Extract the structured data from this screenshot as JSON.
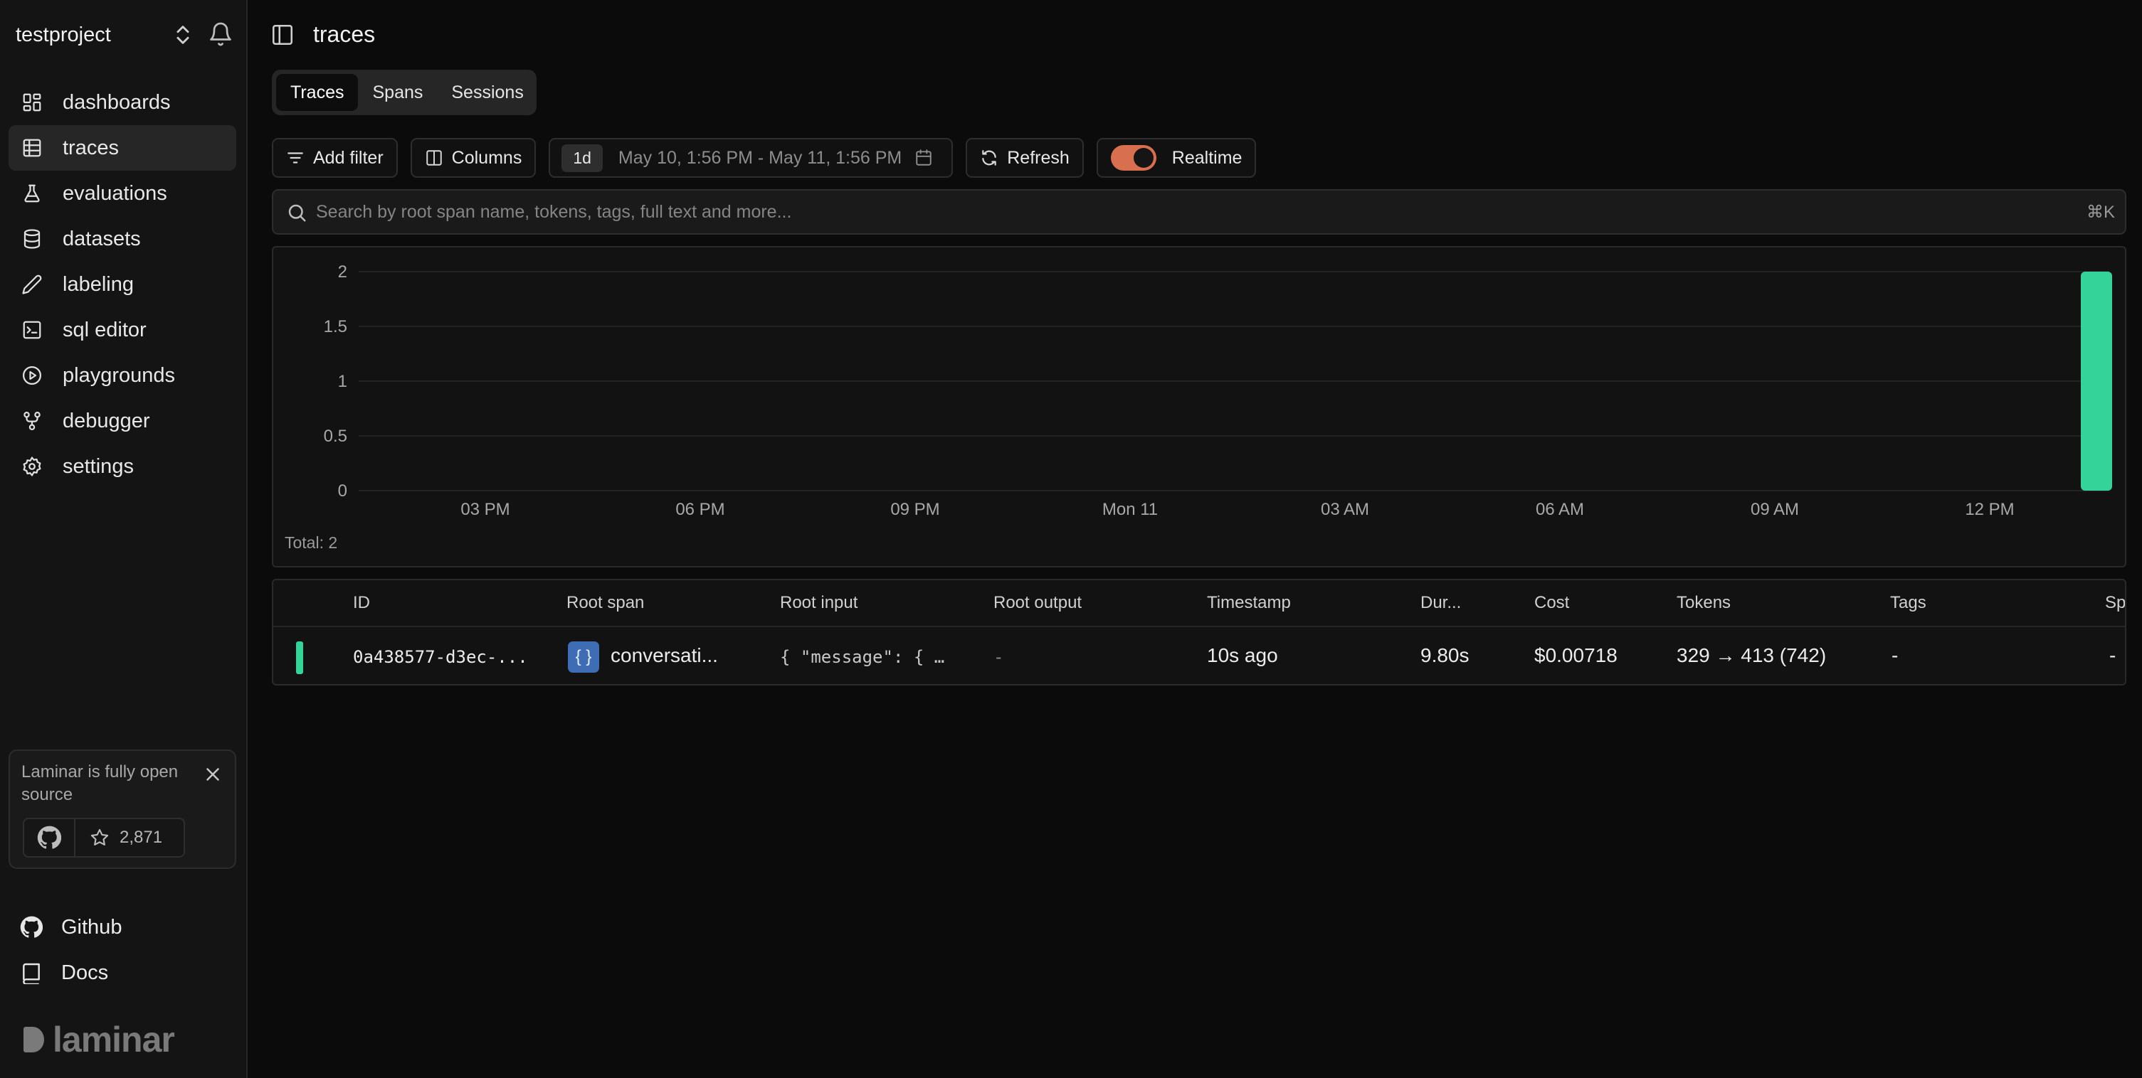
{
  "sidebar": {
    "project_name": "testproject",
    "nav": [
      {
        "label": "dashboards",
        "icon": "dashboard-icon"
      },
      {
        "label": "traces",
        "icon": "rows-icon",
        "active": true
      },
      {
        "label": "evaluations",
        "icon": "flask-icon"
      },
      {
        "label": "datasets",
        "icon": "database-icon"
      },
      {
        "label": "labeling",
        "icon": "pen-icon"
      },
      {
        "label": "sql editor",
        "icon": "terminal-icon"
      },
      {
        "label": "playgrounds",
        "icon": "play-circle-icon"
      },
      {
        "label": "debugger",
        "icon": "git-fork-icon"
      },
      {
        "label": "settings",
        "icon": "gear-icon"
      }
    ],
    "promo": {
      "text": "Laminar is fully open source",
      "stars": "2,871"
    },
    "bottom_links": [
      {
        "label": "Github",
        "icon": "github-icon"
      },
      {
        "label": "Docs",
        "icon": "book-icon"
      }
    ],
    "brand": "laminar"
  },
  "header": {
    "title": "traces"
  },
  "tabs": [
    {
      "label": "Traces",
      "active": true
    },
    {
      "label": "Spans"
    },
    {
      "label": "Sessions"
    }
  ],
  "toolbar": {
    "add_filter": "Add filter",
    "columns": "Columns",
    "range_badge": "1d",
    "range_text": "May 10, 1:56 PM - May 11, 1:56 PM",
    "refresh": "Refresh",
    "realtime": "Realtime",
    "realtime_on": true
  },
  "search": {
    "placeholder": "Search by root span name, tokens, tags, full text and more...",
    "shortcut": "⌘K"
  },
  "chart_data": {
    "type": "bar",
    "y_ticks": [
      "0",
      "0.5",
      "1",
      "1.5",
      "2"
    ],
    "x_ticks": [
      "03 PM",
      "06 PM",
      "09 PM",
      "Mon 11",
      "03 AM",
      "06 AM",
      "09 AM",
      "12 PM"
    ],
    "ylim": [
      0,
      2
    ],
    "bars": [
      {
        "x": "May 11, 1:56 PM",
        "value": 2
      }
    ],
    "color": "#34d399",
    "total_label": "Total: 2"
  },
  "table": {
    "columns": [
      "ID",
      "Root span",
      "Root input",
      "Root output",
      "Timestamp",
      "Dur...",
      "Cost",
      "Tokens",
      "Tags",
      "Sp"
    ],
    "rows": [
      {
        "status_color": "#34d399",
        "id": "0a438577-d3ec-...",
        "span_icon": "{ }",
        "root_span": "conversati...",
        "root_input": "{ \"message\": { …",
        "root_output": "-",
        "timestamp": "10s ago",
        "duration": "9.80s",
        "cost": "$0.00718",
        "tokens": "329 → 413 (742)",
        "tags": "-",
        "sp": "-"
      }
    ]
  }
}
